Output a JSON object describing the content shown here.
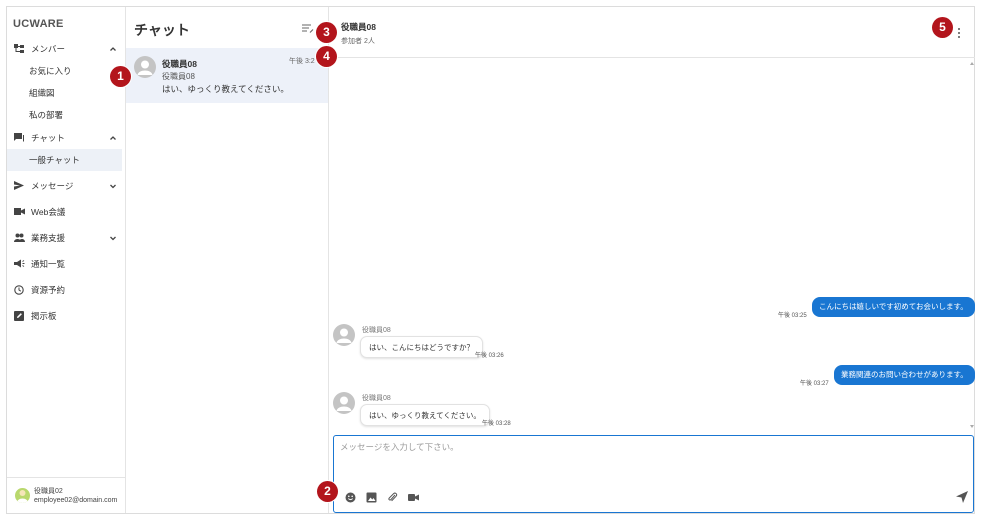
{
  "brand": "UCWARE",
  "sidebar": {
    "items": [
      {
        "label": "メンバー",
        "icon": "org-tree-icon",
        "expanded": true,
        "children": [
          "お気に入り",
          "組織図",
          "私の部署"
        ]
      },
      {
        "label": "チャット",
        "icon": "chat-icon",
        "expanded": true,
        "children": [
          "一般チャット"
        ]
      },
      {
        "label": "メッセージ",
        "icon": "send-icon",
        "expanded": false
      },
      {
        "label": "Web会議",
        "icon": "video-camera-icon"
      },
      {
        "label": "業務支援",
        "icon": "people-icon",
        "expanded": false
      },
      {
        "label": "通知一覧",
        "icon": "megaphone-icon"
      },
      {
        "label": "資源予約",
        "icon": "clock-icon"
      },
      {
        "label": "掲示板",
        "icon": "edit-note-icon"
      }
    ],
    "active_item": "一般チャット"
  },
  "user": {
    "name": "役職員02",
    "email": "employee02@domain.com"
  },
  "chatlist": {
    "title": "チャット",
    "rooms": [
      {
        "name": "役職員08",
        "members": "役職員08",
        "last_message": "はい、ゆっくり教えてください。",
        "time": "午後 3:2"
      }
    ]
  },
  "chat": {
    "title": "役職員08",
    "participants": "参加者 2人",
    "messages": [
      {
        "direction": "out",
        "text": "こんにちは嬉しいです初めてお会いします。",
        "time": "午後 03:25"
      },
      {
        "direction": "in",
        "sender": "役職員08",
        "text": "はい、こんにちはどうですか？",
        "time": "午後 03:26"
      },
      {
        "direction": "out",
        "text": "業務関連のお問い合わせがあります。",
        "time": "午後 03:27"
      },
      {
        "direction": "in",
        "sender": "役職員08",
        "text": "はい、ゆっくり教えてください。",
        "time": "午後 03:28"
      }
    ],
    "composer_placeholder": "メッセージを入力して下さい。",
    "tools": [
      "emoji-icon",
      "image-icon",
      "attach-icon",
      "video-icon"
    ]
  },
  "annotations": [
    "1",
    "2",
    "3",
    "4",
    "5"
  ],
  "colors": {
    "accent": "#1976d2",
    "badge": "#b3151c",
    "selected": "#edf1f9"
  }
}
